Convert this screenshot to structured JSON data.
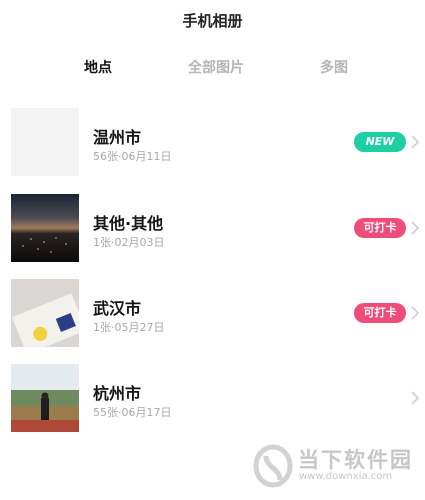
{
  "header": {
    "title": "手机相册"
  },
  "tabs": [
    {
      "label": "地点",
      "active": true
    },
    {
      "label": "全部图片",
      "active": false
    },
    {
      "label": "多图",
      "active": false
    }
  ],
  "albums": [
    {
      "name": "温州市",
      "meta": "56张·06月11日",
      "badge": "NEW",
      "badge_type": "new"
    },
    {
      "name": "其他·其他",
      "meta": "1张·02月03日",
      "badge": "可打卡",
      "badge_type": "checkin"
    },
    {
      "name": "武汉市",
      "meta": "1张·05月27日",
      "badge": "可打卡",
      "badge_type": "checkin"
    },
    {
      "name": "杭州市",
      "meta": "55张·06月17日",
      "badge": "",
      "badge_type": "none"
    }
  ],
  "watermark": {
    "brand": "当下软件园",
    "url": "www.downxia.com"
  },
  "colors": {
    "new_badge": "#1ecfa4",
    "checkin_badge": "#ef4c79"
  }
}
